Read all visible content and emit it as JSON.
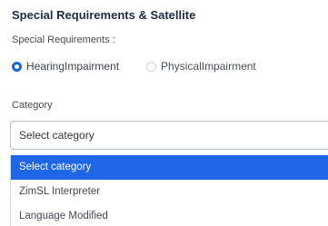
{
  "section": {
    "title": "Special Requirements & Satellite"
  },
  "special_requirements": {
    "label": "Special Requirements :",
    "options": [
      {
        "label": "HearingImpairment",
        "checked": true
      },
      {
        "label": "PhysicalImpairment",
        "checked": false
      }
    ]
  },
  "category": {
    "label": "Category",
    "selected_value": "Select category",
    "options": [
      {
        "label": "Select category",
        "highlighted": true
      },
      {
        "label": "ZimSL Interpreter",
        "highlighted": false
      },
      {
        "label": "Language Modified",
        "highlighted": false
      }
    ]
  },
  "colors": {
    "accent": "#1e66e6",
    "title": "#1f2a44"
  }
}
